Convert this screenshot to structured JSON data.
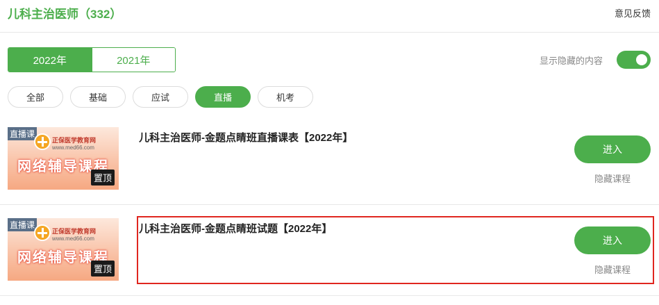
{
  "header": {
    "title": "儿科主治医师（332）",
    "feedback": "意见反馈"
  },
  "year_tabs": [
    {
      "label": "2022年",
      "active": true
    },
    {
      "label": "2021年",
      "active": false
    }
  ],
  "hidden_toggle": {
    "label": "显示隐藏的内容",
    "on": true
  },
  "filters": [
    {
      "label": "全部",
      "active": false
    },
    {
      "label": "基础",
      "active": false
    },
    {
      "label": "应试",
      "active": false
    },
    {
      "label": "直播",
      "active": true
    },
    {
      "label": "机考",
      "active": false
    }
  ],
  "courses": [
    {
      "thumb_tag": "直播课",
      "thumb_brand": "正保医学教育网",
      "thumb_url": "www.med66.com",
      "thumb_headline": "网络辅导课程",
      "thumb_pin": "置顶",
      "title": "儿科主治医师-金题点睛班直播课表【2022年】",
      "enter": "进入",
      "hide": "隐藏课程"
    },
    {
      "thumb_tag": "直播课",
      "thumb_brand": "正保医学教育网",
      "thumb_url": "www.med66.com",
      "thumb_headline": "网络辅导课程",
      "thumb_pin": "置顶",
      "title": "儿科主治医师-金题点睛班试题【2022年】",
      "enter": "进入",
      "hide": "隐藏课程"
    }
  ],
  "colors": {
    "accent": "#4cae4c",
    "highlight": "#e0261f"
  }
}
